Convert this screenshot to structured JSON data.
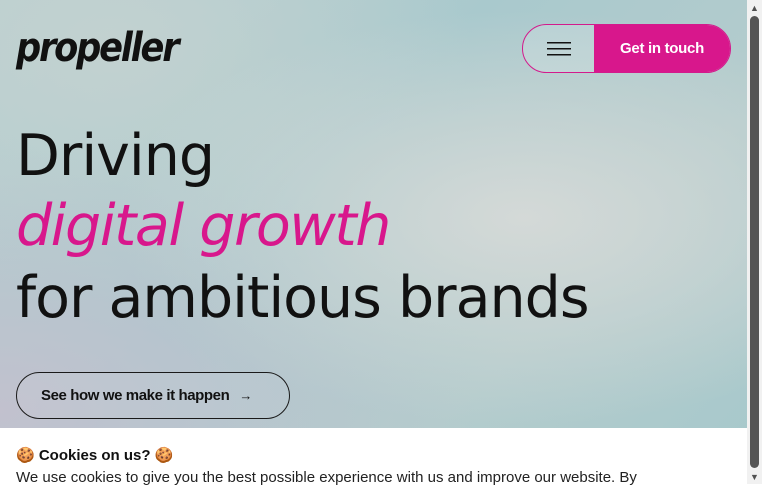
{
  "header": {
    "logo_text": "propeller",
    "menu_icon": "hamburger-icon",
    "cta_label": "Get in touch"
  },
  "hero": {
    "line1": "Driving",
    "line2": "digital growth",
    "line3": "for ambitious brands",
    "button_label": "See how we make it happen",
    "button_icon": "arrow-right-icon",
    "arrow_glyph": "→"
  },
  "cookie_banner": {
    "title": "🍪 Cookies on us? 🍪",
    "text": "We use cookies to give you the best possible experience with us and improve our website. By"
  },
  "scrollbar": {
    "up_glyph": "▲",
    "down_glyph": "▼"
  },
  "colors": {
    "accent": "#d8178c",
    "text": "#111111"
  }
}
